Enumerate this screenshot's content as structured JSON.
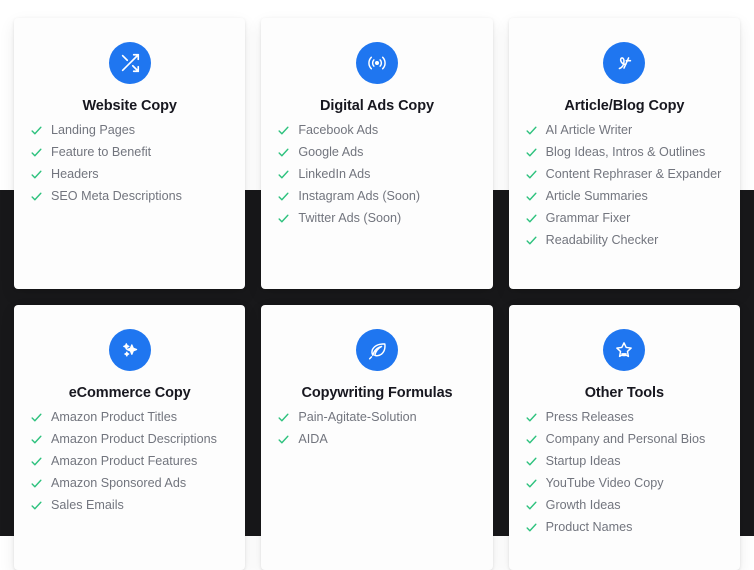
{
  "theme": {
    "page_background": "#18181a",
    "card_background": "#fdfdfd",
    "icon_circle_color": "#1f76f0",
    "check_color": "#2ec27e",
    "title_color": "#17171f",
    "feature_text_color": "#72757e"
  },
  "cards": [
    {
      "id": "website-copy",
      "icon": "shuffle-arrows-icon",
      "title": "Website Copy",
      "features": [
        "Landing Pages",
        "Feature to Benefit",
        "Headers",
        "SEO Meta Descriptions"
      ]
    },
    {
      "id": "digital-ads-copy",
      "icon": "broadcast-signal-icon",
      "title": "Digital Ads Copy",
      "features": [
        "Facebook Ads",
        "Google Ads",
        "LinkedIn Ads",
        "Instagram Ads (Soon)",
        "Twitter Ads (Soon)"
      ]
    },
    {
      "id": "article-blog-copy",
      "icon": "pen-script-icon",
      "title": "Article/Blog Copy",
      "features": [
        "AI Article Writer",
        "Blog Ideas, Intros & Outlines",
        "Content Rephraser & Expander",
        "Article Summaries",
        "Grammar Fixer",
        "Readability Checker"
      ]
    },
    {
      "id": "ecommerce-copy",
      "icon": "sparkles-icon",
      "title": "eCommerce Copy",
      "features": [
        "Amazon Product Titles",
        "Amazon Product Descriptions",
        "Amazon Product Features",
        "Amazon Sponsored Ads",
        "Sales Emails"
      ]
    },
    {
      "id": "copywriting-formulas",
      "icon": "feather-quill-icon",
      "title": "Copywriting Formulas",
      "features": [
        "Pain-Agitate-Solution",
        "AIDA"
      ]
    },
    {
      "id": "other-tools",
      "icon": "star-sparkle-icon",
      "title": "Other Tools",
      "features": [
        "Press Releases",
        "Company and Personal Bios",
        "Startup Ideas",
        "YouTube Video Copy",
        "Growth Ideas",
        "Product Names"
      ]
    }
  ]
}
